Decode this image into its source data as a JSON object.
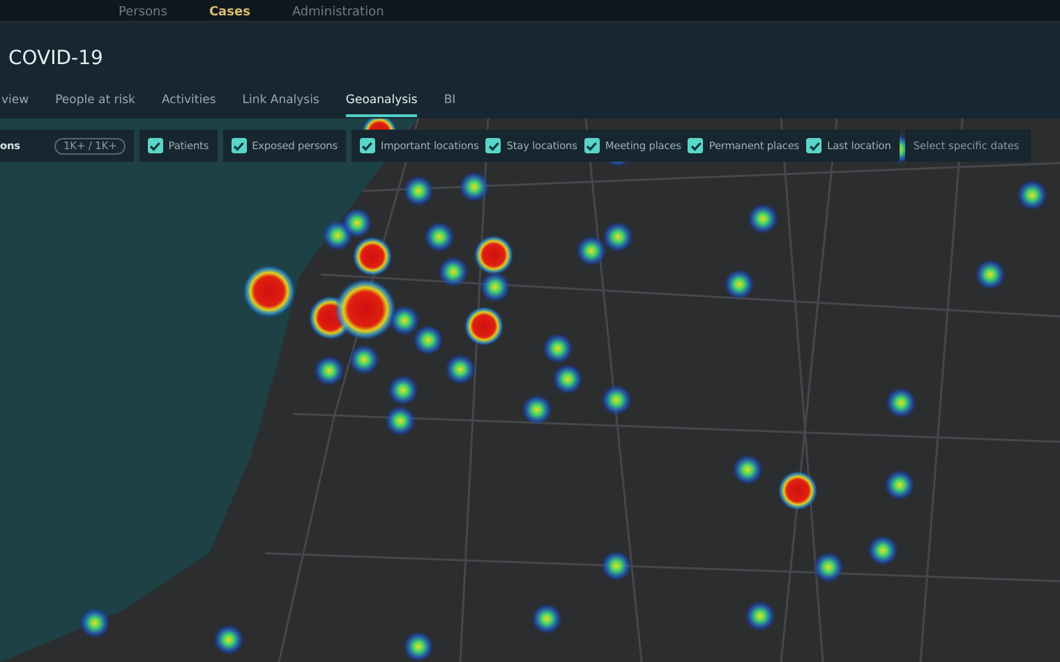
{
  "top_nav": [
    {
      "label": "Persons",
      "selected": false
    },
    {
      "label": "Cases",
      "selected": true
    },
    {
      "label": "Administration",
      "selected": false
    }
  ],
  "title": "COVID-19",
  "tabs": [
    {
      "label": "view",
      "selected": false
    },
    {
      "label": "People at risk",
      "selected": false
    },
    {
      "label": "Activities",
      "selected": false
    },
    {
      "label": "Link Analysis",
      "selected": false
    },
    {
      "label": "Geoanalysis",
      "selected": true
    },
    {
      "label": "BI",
      "selected": false
    }
  ],
  "filter_bar": {
    "label": "ons",
    "count": "1K+ / 1K+",
    "groups": [
      [
        {
          "label": "Patients",
          "checked": true
        }
      ],
      [
        {
          "label": "Exposed persons",
          "checked": true
        }
      ],
      [
        {
          "label": "Important locations",
          "checked": true
        },
        {
          "label": "Stay locations",
          "checked": true
        },
        {
          "label": "Meeting places",
          "checked": true
        },
        {
          "label": "Permanent places",
          "checked": true
        },
        {
          "label": "Last location",
          "checked": true
        }
      ]
    ],
    "date_button": "Select specific dates"
  }
}
